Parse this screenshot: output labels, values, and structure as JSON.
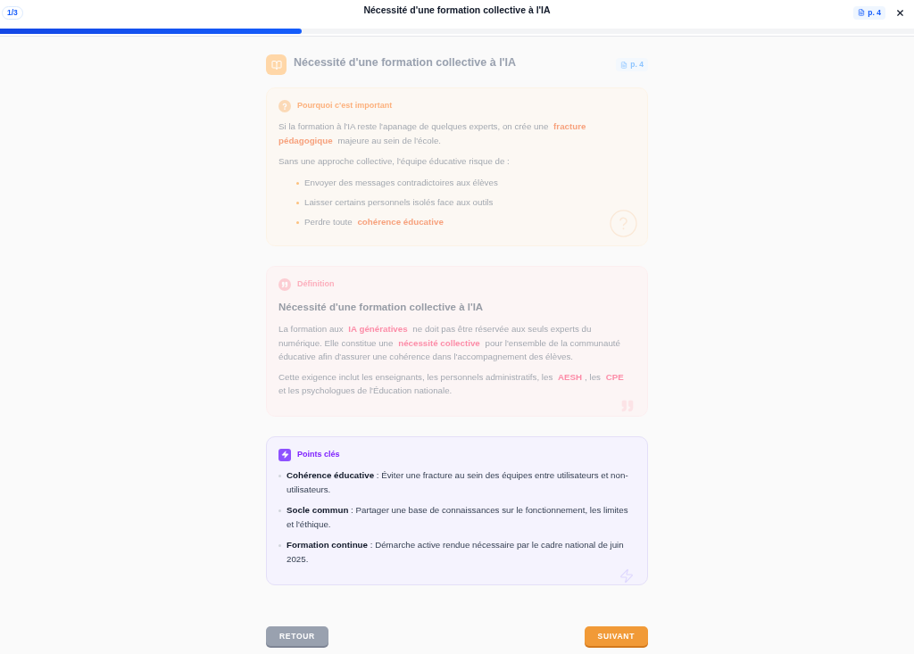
{
  "top_bar": {
    "step": "1/3",
    "title": "Nécessité d'une formation collective à l'IA",
    "page_reference": "p. 4",
    "progress": {
      "level": 0.33
    }
  },
  "header": {
    "title": "Nécessité d'une formation collective à l'IA",
    "page_reference": "p. 4"
  },
  "cards": [
    {
      "kind": "important",
      "dimmed": true,
      "label": "Pourquoi c'est important",
      "paragraphs": [
        "Si la formation à l'IA reste l'apanage de quelques experts, on crée une **fracture pédagogique** majeure au sein de l'école.",
        "Sans une approche collective, l'équipe éducative risque de :"
      ],
      "bullets": [
        "Envoyer des messages contradictoires aux élèves",
        "Laisser certains personnels isolés face aux outils",
        "Perdre toute **cohérence éducative**"
      ]
    },
    {
      "kind": "definition",
      "dimmed": true,
      "label": "Définition",
      "title": "Nécessité d'une formation collective à l'IA",
      "paragraphs": [
        "La formation aux **IA génératives** ne doit pas être réservée aux seuls experts du numérique. Elle constitue une **nécessité collective** pour l'ensemble de la communauté éducative afin d'assurer une cohérence dans l'accompagnement des élèves.",
        "Cette exigence inclut les enseignants, les personnels administratifs, les **AESH**, les **CPE** et les psychologues de l'Éducation nationale."
      ]
    },
    {
      "kind": "key_points",
      "dimmed": false,
      "label": "Points clés",
      "bullets": [
        "**Cohérence éducative** : Éviter une fracture au sein des équipes entre utilisateurs et non-utilisateurs.",
        "**Socle commun** : Partager une base de connaissances sur le fonctionnement, les limites et l'éthique.",
        "**Formation continue** : Démarche active rendue nécessaire par le cadre national de juin 2025."
      ]
    }
  ],
  "buttons": [
    {
      "kind": "back",
      "label": "RETOUR"
    },
    {
      "kind": "next",
      "label": "SUIVANT"
    }
  ]
}
